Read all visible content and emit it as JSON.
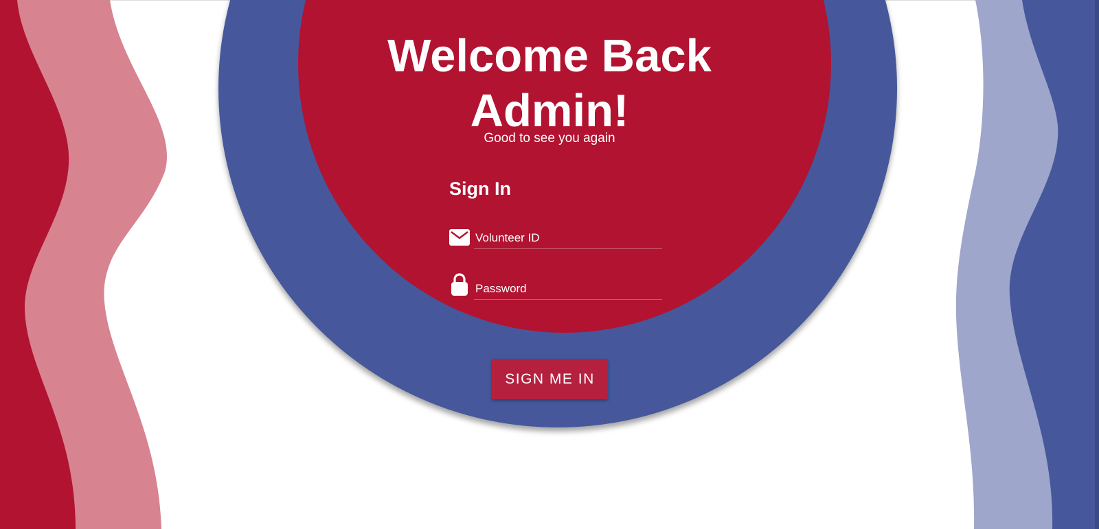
{
  "header": {
    "title_line1": "Welcome Back",
    "title_line2": "Admin!",
    "subtitle": "Good to see you again"
  },
  "form": {
    "heading": "Sign In",
    "fields": [
      {
        "label": "Volunteer ID",
        "icon": "envelope-icon",
        "value": ""
      },
      {
        "label": "Password",
        "icon": "lock-icon",
        "value": ""
      }
    ],
    "submit_label": "SIGN ME IN"
  },
  "colors": {
    "crimson": "#b11331",
    "blue": "#46589b",
    "light_pink": "#d88390",
    "light_blue": "#9ea6cb",
    "button": "#b5203f"
  }
}
